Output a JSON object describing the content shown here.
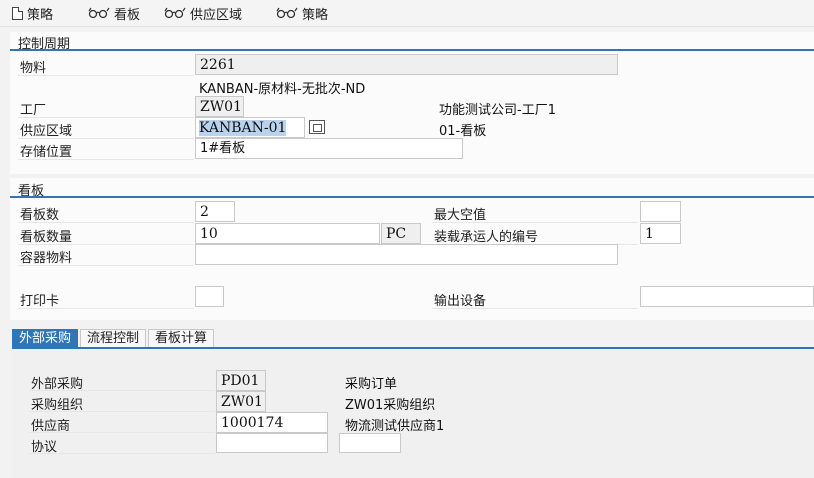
{
  "toolbar": {
    "items": [
      {
        "label": "策略",
        "icon": "new-document-icon"
      },
      {
        "label": "看板",
        "icon": "glasses-icon"
      },
      {
        "label": "供应区域",
        "icon": "glasses-icon"
      },
      {
        "label": "策略",
        "icon": "glasses-icon"
      }
    ]
  },
  "control_cycle": {
    "title": "控制周期",
    "material_label": "物料",
    "material_value": "2261",
    "material_desc": "KANBAN-原材料-无批次-ND",
    "plant_label": "工厂",
    "plant_value": "ZW01",
    "plant_desc": "功能测试公司-工厂1",
    "supply_area_label": "供应区域",
    "supply_area_value": "KANBAN-01",
    "supply_area_desc": "01-看板",
    "storage_label": "存储位置",
    "storage_value": "1#看板"
  },
  "kanban": {
    "title": "看板",
    "count_label": "看板数",
    "count_value": "2",
    "max_empty_label": "最大空值",
    "max_empty_value": "",
    "qty_label": "看板数量",
    "qty_value": "10",
    "qty_unit": "PC",
    "carrier_label": "装载承运人的编号",
    "carrier_value": "1",
    "container_label": "容器物料",
    "container_value": "",
    "print_label": "打印卡",
    "print_value": "",
    "output_label": "输出设备",
    "output_value": ""
  },
  "tabs": [
    "外部采购",
    "流程控制",
    "看板计算"
  ],
  "external": {
    "proc_label": "外部采购",
    "proc_value": "PD01",
    "proc_desc": "采购订单",
    "org_label": "采购组织",
    "org_value": "ZW01",
    "org_desc": "ZW01采购组织",
    "vendor_label": "供应商",
    "vendor_value": "1000174",
    "vendor_desc": "物流测试供应商1",
    "agreement_label": "协议",
    "agreement_value": "",
    "agreement_item": ""
  },
  "colors": {
    "accent": "#2f76b7",
    "selection": "#b9d3ee"
  }
}
